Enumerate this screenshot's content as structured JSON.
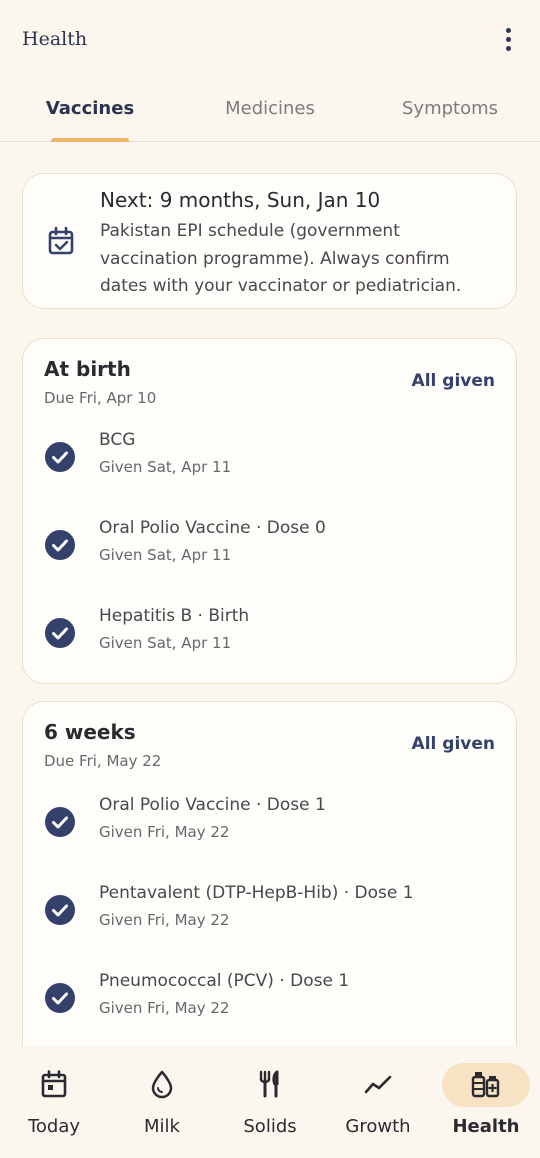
{
  "app": {
    "title": "Health"
  },
  "tabs": [
    {
      "label": "Vaccines",
      "active": true
    },
    {
      "label": "Medicines",
      "active": false
    },
    {
      "label": "Symptoms",
      "active": false
    }
  ],
  "next_card": {
    "icon": "calendar-check-icon",
    "title": "Next: 9 months, Sun, Jan 10",
    "body": "Pakistan EPI schedule (government vaccination programme). Always confirm dates with your vaccinator or pediatrician."
  },
  "groups": [
    {
      "title": "At birth",
      "due": "Due Fri, Apr 10",
      "status": "All given",
      "doses": [
        {
          "name": "BCG",
          "given": "Given Sat, Apr 11"
        },
        {
          "name": "Oral Polio Vaccine · Dose 0",
          "given": "Given Sat, Apr 11"
        },
        {
          "name": "Hepatitis B · Birth",
          "given": "Given Sat, Apr 11"
        }
      ]
    },
    {
      "title": "6 weeks",
      "due": "Due Fri, May 22",
      "status": "All given",
      "doses": [
        {
          "name": "Oral Polio Vaccine · Dose 1",
          "given": "Given Fri, May 22"
        },
        {
          "name": "Pentavalent (DTP-HepB-Hib) · Dose 1",
          "given": "Given Fri, May 22"
        },
        {
          "name": "Pneumococcal (PCV) · Dose 1",
          "given": "Given Fri, May 22"
        }
      ]
    }
  ],
  "nav": [
    {
      "label": "Today",
      "icon": "calendar-icon",
      "active": false
    },
    {
      "label": "Milk",
      "icon": "droplet-icon",
      "active": false
    },
    {
      "label": "Solids",
      "icon": "fork-knife-icon",
      "active": false
    },
    {
      "label": "Growth",
      "icon": "trend-line-icon",
      "active": false
    },
    {
      "label": "Health",
      "icon": "vaccine-vials-icon",
      "active": true
    }
  ],
  "colors": {
    "background": "#fbf7ef",
    "accent": "#f0b56a",
    "primary": "#34416a",
    "active_pill": "#f7e3c3"
  }
}
